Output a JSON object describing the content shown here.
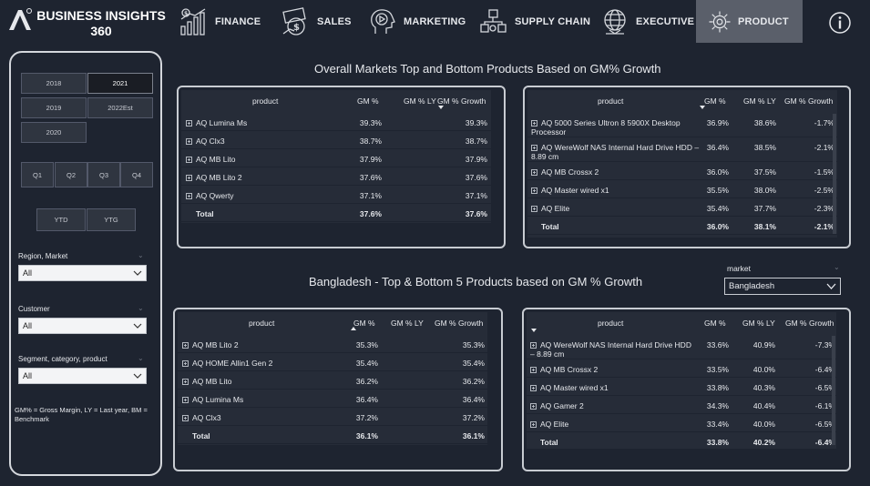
{
  "brand": {
    "line1": "BUSINESS INSIGHTS",
    "line2": "360"
  },
  "nav": [
    {
      "label": "FINANCE",
      "icon": "finance-chart-icon",
      "active": false
    },
    {
      "label": "SALES",
      "icon": "sales-money-icon",
      "active": false
    },
    {
      "label": "MARKETING",
      "icon": "marketing-head-icon",
      "active": false
    },
    {
      "label": "SUPPLY CHAIN",
      "icon": "supply-chain-icon",
      "active": false
    },
    {
      "label": "EXECUTIVE",
      "icon": "executive-globe-icon",
      "active": false
    },
    {
      "label": "PRODUCT",
      "icon": "product-gear-icon",
      "active": true
    }
  ],
  "years": [
    {
      "label": "2018",
      "selected": false
    },
    {
      "label": "2021",
      "selected": true
    },
    {
      "label": "2019",
      "selected": false
    },
    {
      "label": "2022Est",
      "selected": false
    },
    {
      "label": "2020",
      "selected": false
    }
  ],
  "quarters": [
    "Q1",
    "Q2",
    "Q3",
    "Q4"
  ],
  "periods": [
    "YTD",
    "YTG"
  ],
  "filters": [
    {
      "label": "Region, Market",
      "value": "All"
    },
    {
      "label": "Customer",
      "value": "All"
    },
    {
      "label": "Segment, category, product",
      "value": "All"
    }
  ],
  "footnote": "GM% = Gross Margin, LY = Last year, BM = Benchmark",
  "section1_title": "Overall Markets Top and Bottom Products Based on GM% Growth",
  "section2_title": "Bangladesh - Top & Bottom 5 Products based on GM % Growth",
  "market_filter": {
    "label": "market",
    "value": "Bangladesh"
  },
  "columns": {
    "product": "product",
    "gm": "GM %",
    "gm_ly": "GM % LY",
    "gm_growth": "GM % Growth"
  },
  "tables": {
    "overall_top": {
      "rows": [
        {
          "product": "AQ Lumina Ms",
          "gm": "39.3%",
          "gm_ly": "",
          "growth": "39.3%"
        },
        {
          "product": "AQ Clx3",
          "gm": "38.7%",
          "gm_ly": "",
          "growth": "38.7%"
        },
        {
          "product": "AQ MB Lito",
          "gm": "37.9%",
          "gm_ly": "",
          "growth": "37.9%"
        },
        {
          "product": "AQ MB Lito 2",
          "gm": "37.6%",
          "gm_ly": "",
          "growth": "37.6%"
        },
        {
          "product": "AQ Qwerty",
          "gm": "37.1%",
          "gm_ly": "",
          "growth": "37.1%"
        }
      ],
      "total": {
        "label": "Total",
        "gm": "37.6%",
        "gm_ly": "",
        "growth": "37.6%"
      }
    },
    "overall_bottom": {
      "rows": [
        {
          "product": "AQ 5000 Series Ultron 8 5900X Desktop Processor",
          "gm": "36.9%",
          "gm_ly": "38.6%",
          "growth": "-1.7%"
        },
        {
          "product": "AQ WereWolf NAS Internal Hard Drive HDD – 8.89 cm",
          "gm": "36.4%",
          "gm_ly": "38.5%",
          "growth": "-2.1%"
        },
        {
          "product": "AQ MB Crossx 2",
          "gm": "36.0%",
          "gm_ly": "37.5%",
          "growth": "-1.5%"
        },
        {
          "product": "AQ Master wired x1",
          "gm": "35.5%",
          "gm_ly": "38.0%",
          "growth": "-2.5%"
        },
        {
          "product": "AQ Elite",
          "gm": "35.4%",
          "gm_ly": "37.7%",
          "growth": "-2.3%"
        }
      ],
      "total": {
        "label": "Total",
        "gm": "36.0%",
        "gm_ly": "38.1%",
        "growth": "-2.1%"
      }
    },
    "bd_top": {
      "rows": [
        {
          "product": "AQ MB Lito 2",
          "gm": "35.3%",
          "gm_ly": "",
          "growth": "35.3%"
        },
        {
          "product": "AQ HOME Allin1 Gen 2",
          "gm": "35.4%",
          "gm_ly": "",
          "growth": "35.4%"
        },
        {
          "product": "AQ MB Lito",
          "gm": "36.2%",
          "gm_ly": "",
          "growth": "36.2%"
        },
        {
          "product": "AQ Lumina Ms",
          "gm": "36.4%",
          "gm_ly": "",
          "growth": "36.4%"
        },
        {
          "product": "AQ Clx3",
          "gm": "37.2%",
          "gm_ly": "",
          "growth": "37.2%"
        }
      ],
      "total": {
        "label": "Total",
        "gm": "36.1%",
        "gm_ly": "",
        "growth": "36.1%"
      }
    },
    "bd_bottom": {
      "rows": [
        {
          "product": "AQ WereWolf NAS Internal Hard Drive HDD – 8.89 cm",
          "gm": "33.6%",
          "gm_ly": "40.9%",
          "growth": "-7.3%"
        },
        {
          "product": "AQ MB Crossx 2",
          "gm": "33.5%",
          "gm_ly": "40.0%",
          "growth": "-6.4%"
        },
        {
          "product": "AQ Master wired x1",
          "gm": "33.8%",
          "gm_ly": "40.3%",
          "growth": "-6.5%"
        },
        {
          "product": "AQ Gamer 2",
          "gm": "34.3%",
          "gm_ly": "40.4%",
          "growth": "-6.1%"
        },
        {
          "product": "AQ Elite",
          "gm": "33.4%",
          "gm_ly": "40.0%",
          "growth": "-6.5%"
        }
      ],
      "total": {
        "label": "Total",
        "gm": "33.8%",
        "gm_ly": "40.2%",
        "growth": "-6.4%"
      }
    }
  }
}
